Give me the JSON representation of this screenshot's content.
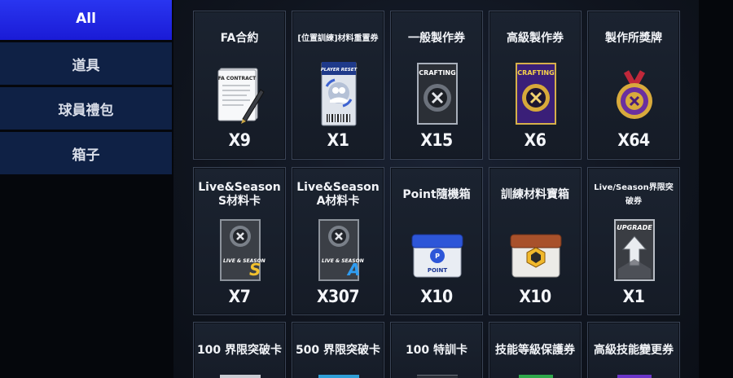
{
  "sidebar": {
    "items": [
      {
        "label": "All",
        "active": true
      },
      {
        "label": "道具",
        "active": false
      },
      {
        "label": "球員禮包",
        "active": false
      },
      {
        "label": "箱子",
        "active": false
      }
    ]
  },
  "items": [
    {
      "name": "FA合約",
      "qty": "X9",
      "icon": "fa-contract-icon",
      "icon_text": "FA CONTRACT"
    },
    {
      "name": "[位置訓練]材料重置券",
      "qty": "X1",
      "icon": "player-reset-ticket-icon",
      "icon_text": "PLAYER RESET"
    },
    {
      "name": "一般製作券",
      "qty": "X15",
      "icon": "crafting-ticket-icon",
      "icon_text": "CRAFTING"
    },
    {
      "name": "高級製作券",
      "qty": "X6",
      "icon": "premium-crafting-ticket-icon",
      "icon_text": "CRAFTING"
    },
    {
      "name": "製作所獎牌",
      "qty": "X64",
      "icon": "crafting-medal-icon"
    },
    {
      "name": "Live&Season\nS材料卡",
      "qty": "X7",
      "icon": "live-season-s-card-icon",
      "icon_text": "LIVE & SEASON",
      "grade": "S"
    },
    {
      "name": "Live&Season\nA材料卡",
      "qty": "X307",
      "icon": "live-season-a-card-icon",
      "icon_text": "LIVE & SEASON",
      "grade": "A"
    },
    {
      "name": "Point隨機箱",
      "qty": "X10",
      "icon": "point-random-box-icon",
      "icon_text": "POINT"
    },
    {
      "name": "訓練材料寶箱",
      "qty": "X10",
      "icon": "training-material-chest-icon"
    },
    {
      "name": "Live/Season界限突破券",
      "qty": "X1",
      "icon": "upgrade-ticket-icon",
      "icon_text": "UPGRADE"
    },
    {
      "name": "100 界限突破卡",
      "qty": "",
      "icon": "limit-break-card-100-icon"
    },
    {
      "name": "500 界限突破卡",
      "qty": "",
      "icon": "limit-break-card-500-icon"
    },
    {
      "name": "100 特訓卡",
      "qty": "",
      "icon": "special-training-card-icon"
    },
    {
      "name": "技能等級保護券",
      "qty": "",
      "icon": "skill-level-protect-ticket-icon"
    },
    {
      "name": "高級技能變更券",
      "qty": "",
      "icon": "premium-skill-change-ticket-icon"
    }
  ],
  "colors": {
    "sidebar_active": "#2027e6",
    "sidebar_inactive": "#0f2145",
    "card_border": "#3a4456",
    "background": "#05070c"
  }
}
